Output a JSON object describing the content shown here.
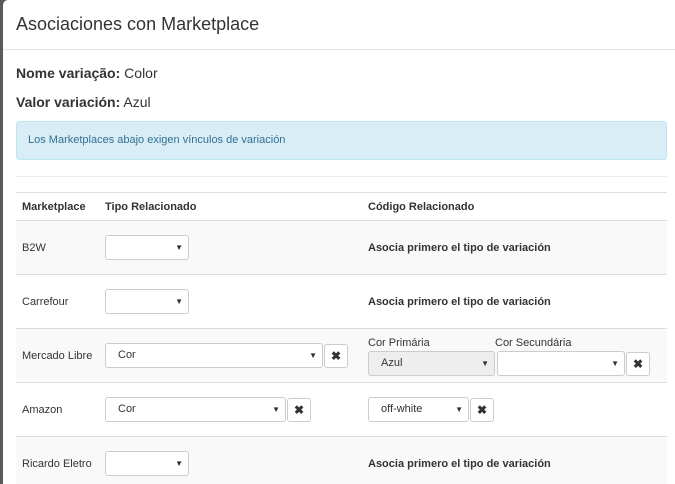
{
  "modal": {
    "title": "Asociaciones con Marketplace"
  },
  "variation": {
    "name_label": "Nome variação:",
    "name_value": "Color",
    "value_label": "Valor variación:",
    "value_value": "Azul"
  },
  "alert": {
    "text": "Los Marketplaces abajo exigen vínculos de variación"
  },
  "table": {
    "headers": [
      "Marketplace",
      "Tipo Relacionado",
      "Código Relacionado"
    ],
    "rows": [
      {
        "marketplace": "B2W",
        "tipo": "",
        "codigo_note": "Asocia primero el tipo de variación"
      },
      {
        "marketplace": "Carrefour",
        "tipo": "",
        "codigo_note": "Asocia primero el tipo de variación"
      },
      {
        "marketplace": "Mercado Libre",
        "tipo": "Cor",
        "primary_label": "Cor Primária",
        "primary_value": "Azul",
        "secondary_label": "Cor Secundária",
        "secondary_value": ""
      },
      {
        "marketplace": "Amazon",
        "tipo": "Cor",
        "codigo_value": "off-white"
      },
      {
        "marketplace": "Ricardo Eletro",
        "tipo": "",
        "codigo_note": "Asocia primero el tipo de variación"
      }
    ]
  },
  "icons": {
    "caret": "▼",
    "remove": "✖"
  }
}
